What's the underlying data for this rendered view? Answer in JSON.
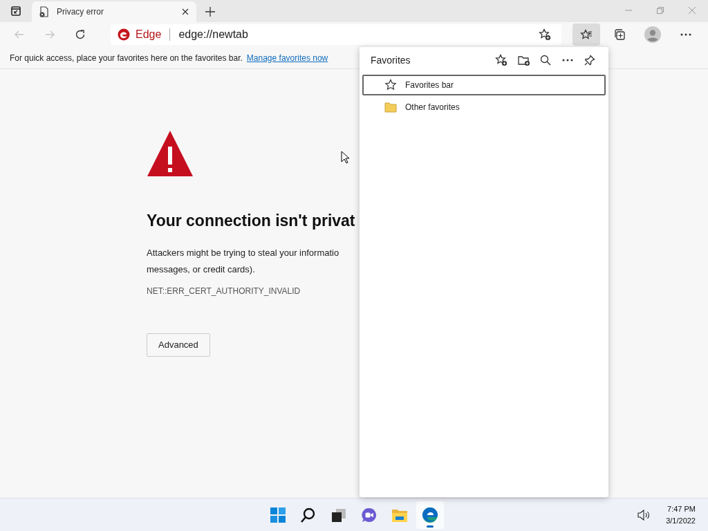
{
  "tab_strip": {
    "tabs": [
      {
        "title": "Privacy error",
        "selected": true
      }
    ]
  },
  "nav_buttons": [
    {
      "kind": "back",
      "disabled": true
    },
    {
      "kind": "forward",
      "disabled": true
    },
    {
      "kind": "reload",
      "disabled": false
    }
  ],
  "address_bar": {
    "site_label": "Edge",
    "url": "edge://newtab"
  },
  "toolbar_buttons": [
    {
      "kind": "add-favorite",
      "selected": false
    },
    {
      "kind": "favorites",
      "selected": true
    },
    {
      "kind": "collections",
      "selected": false
    },
    {
      "kind": "profile",
      "selected": false
    },
    {
      "kind": "more",
      "selected": false
    }
  ],
  "favorites_bar_hint": {
    "text": "For quick access, place your favorites here on the favorites bar.",
    "link": "Manage favorites now"
  },
  "error_page": {
    "title": "Your connection isn't privat",
    "message_lines": [
      "Attackers might be trying to steal your informatio",
      "messages, or credit cards)."
    ],
    "error_code": "NET::ERR_CERT_AUTHORITY_INVALID",
    "button": "Advanced"
  },
  "favorites_panel": {
    "title": "Favorites",
    "actions": [
      {
        "kind": "add-favorite"
      },
      {
        "kind": "add-folder"
      },
      {
        "kind": "search"
      },
      {
        "kind": "more"
      },
      {
        "kind": "pin"
      }
    ],
    "items": [
      {
        "kind": "star",
        "label": "Favorites bar",
        "selected": true
      },
      {
        "kind": "folder",
        "label": "Other favorites",
        "selected": false
      }
    ]
  },
  "taskbar": {
    "apps": [
      {
        "kind": "start",
        "active": false
      },
      {
        "kind": "search",
        "active": false
      },
      {
        "kind": "task-view",
        "active": false
      },
      {
        "kind": "chat",
        "active": false
      },
      {
        "kind": "explorer",
        "active": false
      },
      {
        "kind": "edge",
        "active": true
      }
    ],
    "time": "7:47 PM",
    "date": "3/1/2022"
  }
}
